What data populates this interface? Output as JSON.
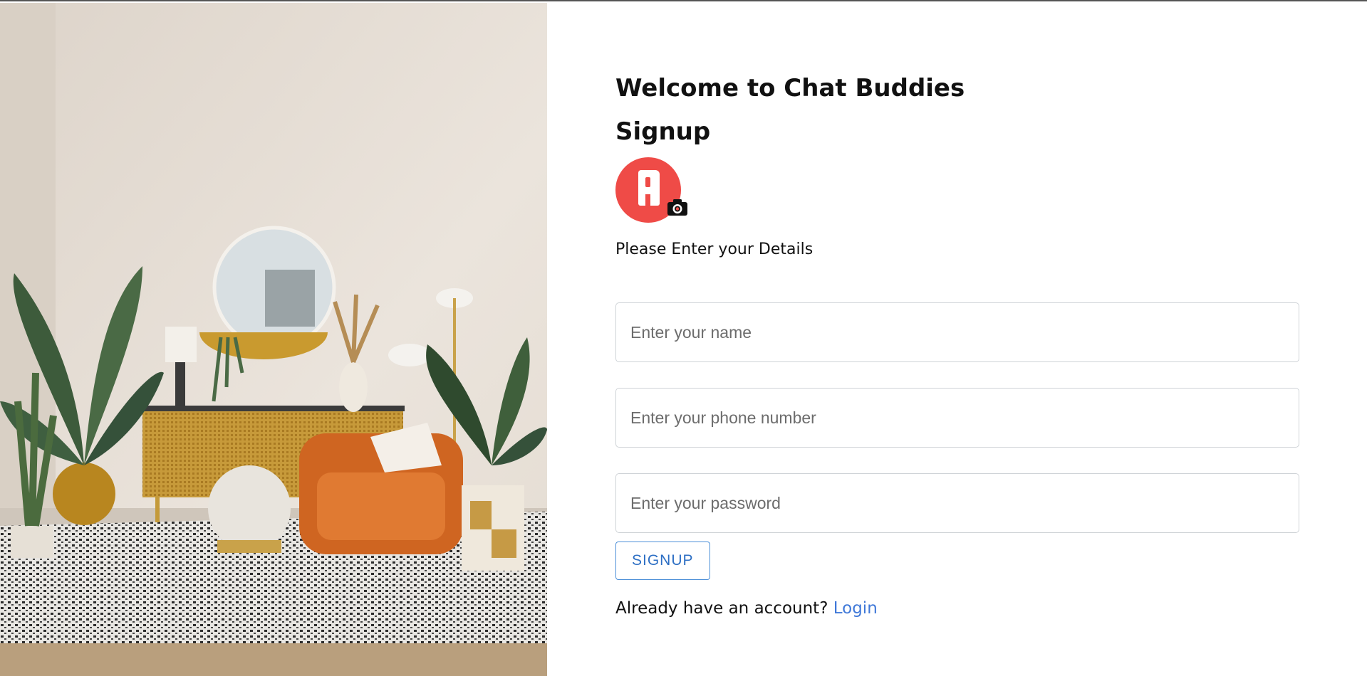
{
  "hero": {
    "alt": "living room interior"
  },
  "form": {
    "welcome": "Welcome to Chat Buddies",
    "title": "Signup",
    "subtitle": "Please Enter your Details",
    "name_placeholder": "Enter your name",
    "phone_placeholder": "Enter your phone number",
    "password_placeholder": "Enter your password",
    "submit_label": "SIGNUP",
    "already_text": "Already have an account?",
    "login_link": "Login"
  },
  "icons": {
    "avatar": "avatar-upload-icon",
    "camera": "camera-icon"
  },
  "colors": {
    "accent": "#3f78d8",
    "avatar": "#ef4b47"
  }
}
